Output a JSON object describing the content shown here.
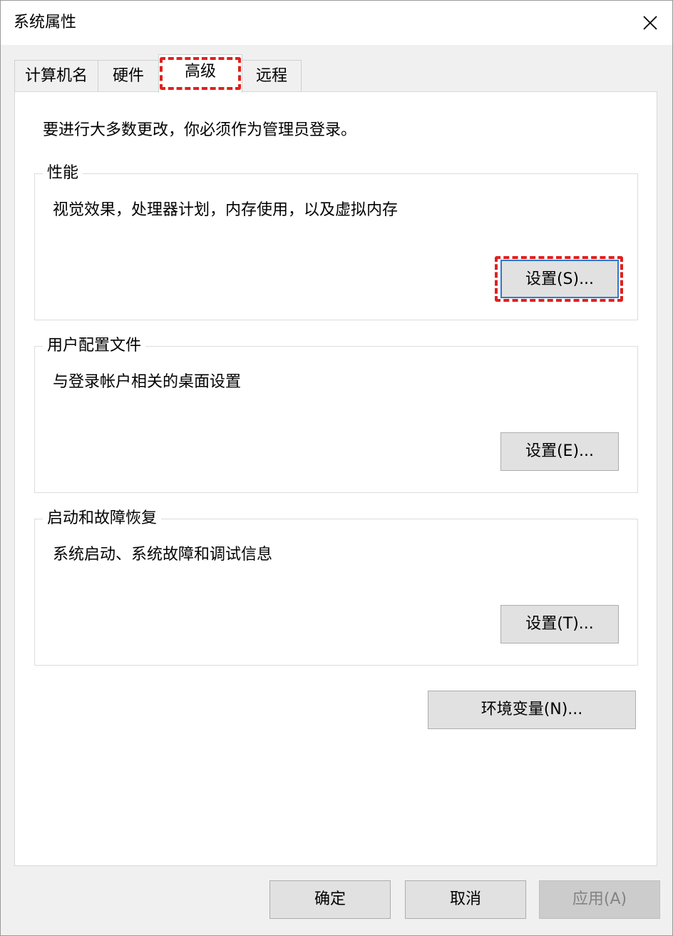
{
  "window": {
    "title": "系统属性"
  },
  "tabs": [
    {
      "label": "计算机名",
      "selected": false
    },
    {
      "label": "硬件",
      "selected": false
    },
    {
      "label": "高级",
      "selected": true
    },
    {
      "label": "远程",
      "selected": false
    }
  ],
  "advanced": {
    "admin_note": "要进行大多数更改，你必须作为管理员登录。",
    "performance": {
      "label": "性能",
      "description": "视觉效果，处理器计划，内存使用，以及虚拟内存",
      "button": "设置(S)..."
    },
    "user_profiles": {
      "label": "用户配置文件",
      "description": "与登录帐户相关的桌面设置",
      "button": "设置(E)..."
    },
    "startup_recovery": {
      "label": "启动和故障恢复",
      "description": "系统启动、系统故障和调试信息",
      "button": "设置(T)..."
    },
    "env_button": "环境变量(N)..."
  },
  "footer": {
    "ok": "确定",
    "cancel": "取消",
    "apply": "应用(A)"
  },
  "colors": {
    "highlight": "#e0201c",
    "focus_border": "#2b7ad1"
  },
  "icons": {
    "close": "close-icon"
  }
}
